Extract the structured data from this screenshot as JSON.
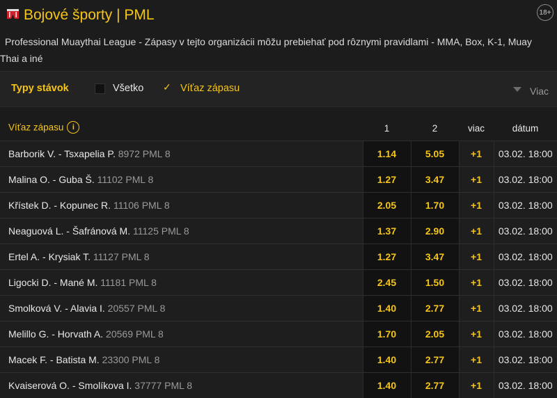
{
  "header": {
    "sport": "Bojové športy",
    "separator": "|",
    "league": "PML",
    "age_badge": "18+"
  },
  "description": "Professional Muaythai League - Zápasy v tejto organizácii môžu prebiehať pod rôznymi pravidlami - MMA, Box, K-1, Muay Thai a iné",
  "filters": {
    "label": "Typy stávok",
    "options": [
      {
        "label": "Všetko",
        "checked": false
      },
      {
        "label": "Víťaz zápasu",
        "checked": true
      }
    ],
    "more_label": "Viac"
  },
  "table": {
    "columns": {
      "market": "Víťaz zápasu",
      "one": "1",
      "two": "2",
      "more": "viac",
      "date": "dátum"
    },
    "rows": [
      {
        "match": "Barborik V. - Tsxapelia P.",
        "code": "8972 PML 8",
        "one": "1.14",
        "two": "5.05",
        "more": "+1",
        "date": "03.02. 18:00"
      },
      {
        "match": "Malina O. - Guba Š.",
        "code": "11102 PML 8",
        "one": "1.27",
        "two": "3.47",
        "more": "+1",
        "date": "03.02. 18:00"
      },
      {
        "match": "Křístek D. - Kopunec R.",
        "code": "11106 PML 8",
        "one": "2.05",
        "two": "1.70",
        "more": "+1",
        "date": "03.02. 18:00"
      },
      {
        "match": "Neaguová L. - Šafránová M.",
        "code": "11125 PML 8",
        "one": "1.37",
        "two": "2.90",
        "more": "+1",
        "date": "03.02. 18:00"
      },
      {
        "match": "Ertel A. - Krysiak T.",
        "code": "11127 PML 8",
        "one": "1.27",
        "two": "3.47",
        "more": "+1",
        "date": "03.02. 18:00"
      },
      {
        "match": "Ligocki D. - Mané M.",
        "code": "11181 PML 8",
        "one": "2.45",
        "two": "1.50",
        "more": "+1",
        "date": "03.02. 18:00"
      },
      {
        "match": "Smolková V. - Alavia I.",
        "code": "20557 PML 8",
        "one": "1.40",
        "two": "2.77",
        "more": "+1",
        "date": "03.02. 18:00"
      },
      {
        "match": "Melillo G. - Horvath A.",
        "code": "20569 PML 8",
        "one": "1.70",
        "two": "2.05",
        "more": "+1",
        "date": "03.02. 18:00"
      },
      {
        "match": "Macek F. - Batista M.",
        "code": "23300 PML 8",
        "one": "1.40",
        "two": "2.77",
        "more": "+1",
        "date": "03.02. 18:00"
      },
      {
        "match": "Kvaiserová O. - Smolíkova I.",
        "code": "37777 PML 8",
        "one": "1.40",
        "two": "2.77",
        "more": "+1",
        "date": "03.02. 18:00"
      }
    ]
  }
}
